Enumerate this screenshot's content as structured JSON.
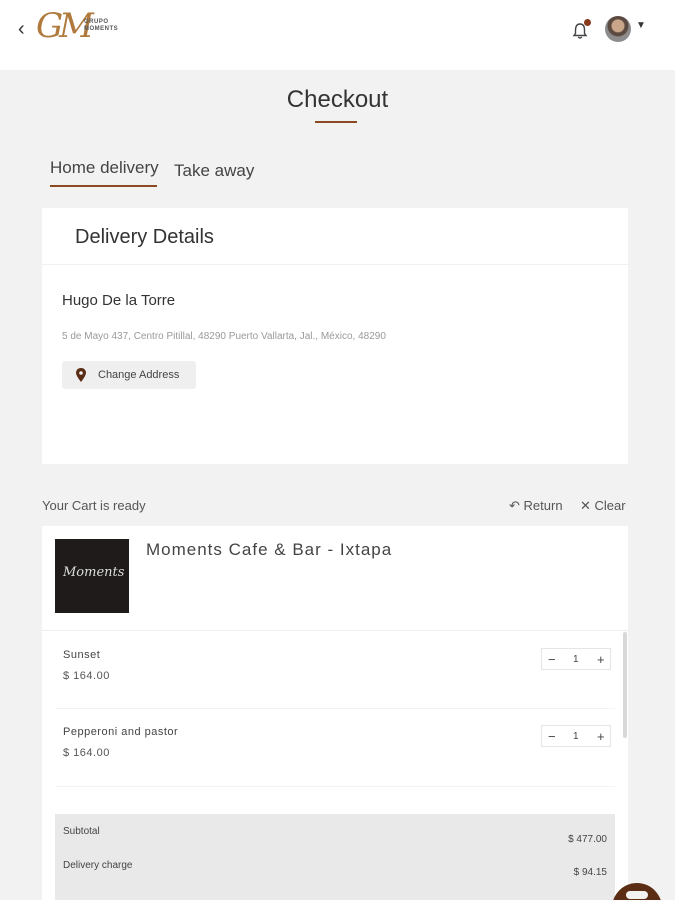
{
  "header": {
    "logo_mark": "GM",
    "logo_text_line1": "GRUPO",
    "logo_text_line2": "MOMENTS",
    "back_icon": "chevron-left-icon",
    "notification_icon": "bell-icon",
    "avatar_caret_icon": "caret-down-icon"
  },
  "page": {
    "title": "Checkout"
  },
  "tabs": [
    {
      "label": "Home delivery",
      "active": true
    },
    {
      "label": "Take away",
      "active": false
    }
  ],
  "delivery": {
    "title": "Delivery Details",
    "customer_name": "Hugo De la Torre",
    "address": "5 de Mayo 437, Centro Pitillal, 48290 Puerto Vallarta, Jal., México, 48290",
    "change_address_label": "Change Address"
  },
  "cart": {
    "status_text": "Your Cart is ready",
    "return_label": "Return",
    "clear_label": "Clear",
    "store_name": "Moments Cafe & Bar - Ixtapa",
    "store_logo_text": "Moments",
    "items": [
      {
        "name": "Sunset",
        "price": "$ 164.00",
        "quantity": "1"
      },
      {
        "name": "Pepperoni and pastor",
        "price": "$ 164.00",
        "quantity": "1"
      }
    ],
    "subtotal_label": "Subtotal",
    "subtotal_value": "$ 477.00",
    "delivery_charge_label": "Delivery charge",
    "delivery_charge_value": "$ 94.15"
  },
  "colors": {
    "accent": "#8a4a24",
    "fab": "#5a2d14"
  }
}
